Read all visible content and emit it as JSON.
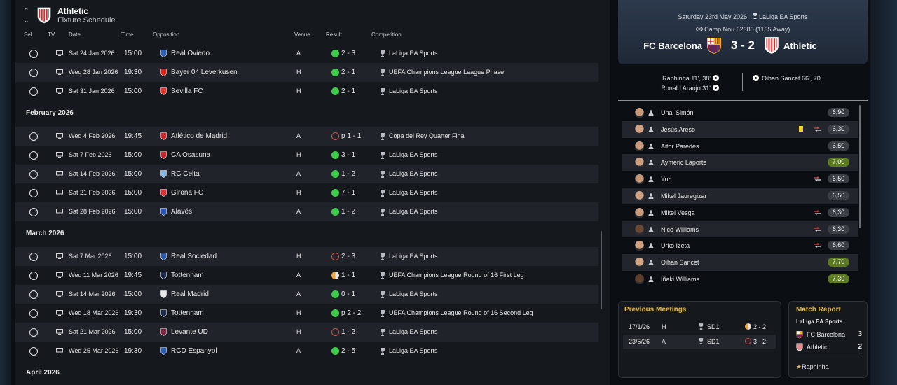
{
  "header": {
    "club": "Athletic",
    "subtitle": "Fixture Schedule"
  },
  "columns": {
    "sel": "Sel.",
    "tv": "TV",
    "date": "Date",
    "time": "Time",
    "opposition": "Opposition",
    "venue": "Venue",
    "result": "Result",
    "competition": "Competition"
  },
  "rows_jan": [
    {
      "date": "Sat 24 Jan 2026",
      "time": "15:00",
      "opp": "Real Oviedo",
      "venue": "A",
      "res": "2 - 3",
      "outcome": "win",
      "comp": "LaLiga EA Sports",
      "crest": "#2f5fb3"
    },
    {
      "date": "Wed 28 Jan 2026",
      "time": "19:30",
      "opp": "Bayer 04 Leverkusen",
      "venue": "H",
      "res": "2 - 1",
      "outcome": "win",
      "comp": "UEFA Champions League League Phase",
      "crest": "#d8261f"
    },
    {
      "date": "Sat 31 Jan 2026",
      "time": "15:00",
      "opp": "Sevilla FC",
      "venue": "H",
      "res": "2 - 1",
      "outcome": "win",
      "comp": "LaLiga EA Sports",
      "crest": "#e0362b"
    }
  ],
  "month_feb": "February 2026",
  "rows_feb": [
    {
      "date": "Wed 4 Feb 2026",
      "time": "19:45",
      "opp": "Atlético de Madrid",
      "venue": "A",
      "res": "p 1 - 1",
      "outcome": "loss",
      "comp": "Copa del Rey Quarter Final",
      "crest": "#cc2a2a"
    },
    {
      "date": "Sat 7 Feb 2026",
      "time": "15:00",
      "opp": "CA Osasuna",
      "venue": "H",
      "res": "3 - 1",
      "outcome": "win",
      "comp": "LaLiga EA Sports",
      "crest": "#c4262e"
    },
    {
      "date": "Sat 14 Feb 2026",
      "time": "15:00",
      "opp": "RC Celta",
      "venue": "A",
      "res": "1 - 2",
      "outcome": "win",
      "comp": "LaLiga EA Sports",
      "crest": "#8bb7e0"
    },
    {
      "date": "Sat 21 Feb 2026",
      "time": "15:00",
      "opp": "Girona FC",
      "venue": "H",
      "res": "7 - 1",
      "outcome": "win",
      "comp": "LaLiga EA Sports",
      "crest": "#d8323a"
    },
    {
      "date": "Sat 28 Feb 2026",
      "time": "15:00",
      "opp": "Alavés",
      "venue": "A",
      "res": "1 - 2",
      "outcome": "win",
      "comp": "LaLiga EA Sports",
      "crest": "#2a55b8"
    }
  ],
  "month_mar": "March 2026",
  "rows_mar": [
    {
      "date": "Sat 7 Mar 2026",
      "time": "15:00",
      "opp": "Real Sociedad",
      "venue": "H",
      "res": "2 - 3",
      "outcome": "loss",
      "comp": "LaLiga EA Sports",
      "crest": "#2c5aa8"
    },
    {
      "date": "Wed 11 Mar 2026",
      "time": "19:45",
      "opp": "Tottenham",
      "venue": "A",
      "res": "1 - 1",
      "outcome": "draw",
      "comp": "UEFA Champions League Round of 16 First Leg",
      "crest": "#1c2a4a"
    },
    {
      "date": "Sat 14 Mar 2026",
      "time": "15:00",
      "opp": "Real Madrid",
      "venue": "A",
      "res": "0 - 1",
      "outcome": "win",
      "comp": "LaLiga EA Sports",
      "crest": "#e8e8e8"
    },
    {
      "date": "Wed 18 Mar 2026",
      "time": "19:30",
      "opp": "Tottenham",
      "venue": "H",
      "res": "p 2 - 2",
      "outcome": "win",
      "comp": "UEFA Champions League Round of 16 Second Leg",
      "crest": "#1c2a4a"
    },
    {
      "date": "Sat 21 Mar 2026",
      "time": "15:00",
      "opp": "Levante UD",
      "venue": "H",
      "res": "1 - 2",
      "outcome": "loss",
      "comp": "LaLiga EA Sports",
      "crest": "#7a2340"
    },
    {
      "date": "Wed 25 Mar 2026",
      "time": "19:30",
      "opp": "RCD Espanyol",
      "venue": "A",
      "res": "2 - 5",
      "outcome": "win",
      "comp": "LaLiga EA Sports",
      "crest": "#2d5db3"
    }
  ],
  "month_apr": "April 2026",
  "match": {
    "date": "Saturday 23rd May 2026",
    "competition": "LaLiga EA Sports",
    "venue": "Camp Nou",
    "attendance": "62385 (1135 Away)",
    "home": "FC Barcelona",
    "away": "Athletic",
    "score": "3 - 2",
    "home_goals": [
      "Raphinha 11', 38'",
      "Ronald Araujo 31'"
    ],
    "away_goals": [
      "Oihan Sancet 66', 70'"
    ]
  },
  "players": [
    {
      "name": "Unai Simón",
      "rating": "6,90",
      "card": false,
      "sub": false,
      "good": false,
      "skin": "#c89a7a"
    },
    {
      "name": "Jesús Areso",
      "rating": "6,30",
      "card": true,
      "sub": true,
      "good": false,
      "skin": "#d4a587"
    },
    {
      "name": "Aitor Paredes",
      "rating": "6,50",
      "card": false,
      "sub": false,
      "good": false,
      "skin": "#c99a7c"
    },
    {
      "name": "Aymeric Laporte",
      "rating": "7,00",
      "card": false,
      "sub": false,
      "good": true,
      "skin": "#cfa283"
    },
    {
      "name": "Yuri",
      "rating": "6,50",
      "card": false,
      "sub": true,
      "good": false,
      "skin": "#c69878"
    },
    {
      "name": "Mikel Jauregizar",
      "rating": "6,50",
      "card": false,
      "sub": false,
      "good": false,
      "skin": "#d0a385"
    },
    {
      "name": "Mikel Vesga",
      "rating": "6,30",
      "card": false,
      "sub": true,
      "good": false,
      "skin": "#c89b7d"
    },
    {
      "name": "Nico Williams",
      "rating": "6,30",
      "card": false,
      "sub": true,
      "good": false,
      "skin": "#6b4a35"
    },
    {
      "name": "Urko Izeta",
      "rating": "6,60",
      "card": false,
      "sub": true,
      "good": false,
      "skin": "#cfa080"
    },
    {
      "name": "Oihan Sancet",
      "rating": "7,70",
      "card": false,
      "sub": false,
      "good": true,
      "skin": "#d1a586"
    },
    {
      "name": "Iñaki Williams",
      "rating": "7,30",
      "card": false,
      "sub": false,
      "good": true,
      "skin": "#5e3f2c"
    }
  ],
  "previous_meetings": {
    "title": "Previous Meetings",
    "rows": [
      {
        "date": "17/1/26",
        "venue": "H",
        "comp": "SD1",
        "result": "2 - 2",
        "outcome": "draw"
      },
      {
        "date": "23/5/26",
        "venue": "A",
        "comp": "SD1",
        "result": "3 - 2",
        "outcome": "loss"
      }
    ]
  },
  "match_report": {
    "title": "Match Report",
    "competition": "LaLiga EA Sports",
    "home": "FC Barcelona",
    "home_score": "3",
    "away": "Athletic",
    "away_score": "2",
    "motm": "Raphinha"
  },
  "colors": {
    "win": "#3dcc4a",
    "loss": "#e0493e",
    "draw": "#f0a23a",
    "accent": "#e6b84a"
  }
}
